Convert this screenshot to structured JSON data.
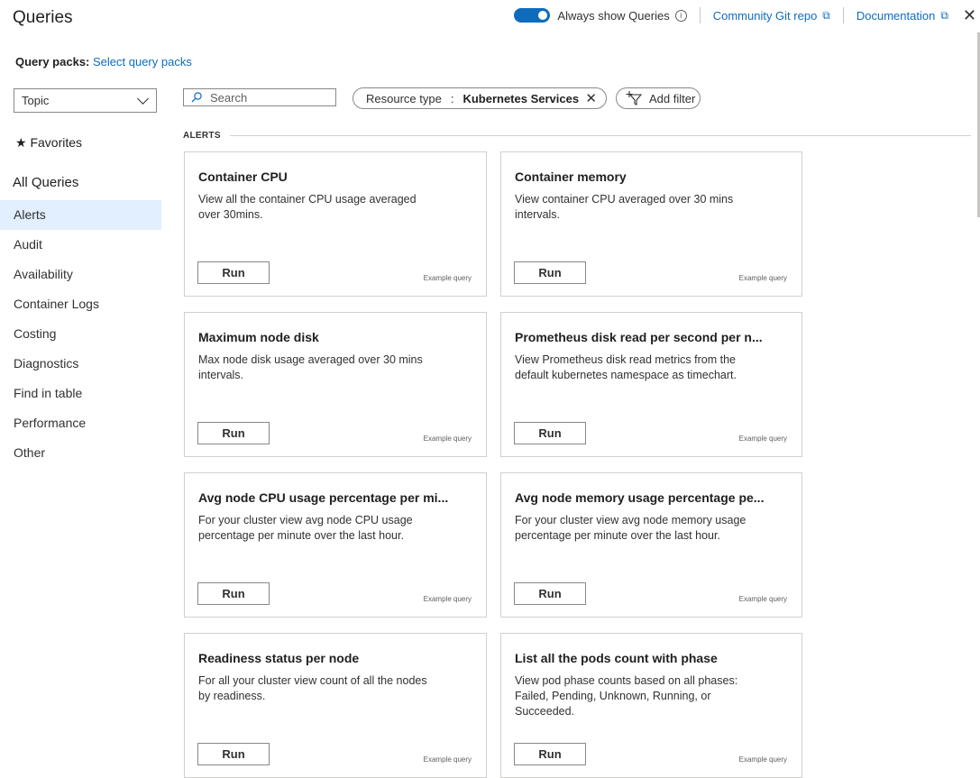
{
  "header": {
    "title": "Queries",
    "always_show_label": "Always show Queries",
    "community_link": "Community Git repo",
    "docs_link": "Documentation",
    "accent": "#0f6cbd"
  },
  "query_packs": {
    "label": "Query packs:",
    "link": "Select query packs"
  },
  "topic_select": {
    "value": "Topic"
  },
  "search": {
    "placeholder": "Search"
  },
  "filter": {
    "resource_type_label": "Resource type",
    "separator": ":",
    "resource_type_value": "Kubernetes Services",
    "add_filter_label": "Add filter"
  },
  "sidebar": {
    "favorites": "Favorites",
    "all_queries": "All Queries",
    "categories": [
      {
        "label": "Alerts",
        "active": true
      },
      {
        "label": "Audit"
      },
      {
        "label": "Availability"
      },
      {
        "label": "Container Logs"
      },
      {
        "label": "Costing"
      },
      {
        "label": "Diagnostics"
      },
      {
        "label": "Find in table"
      },
      {
        "label": "Performance"
      },
      {
        "label": "Other"
      }
    ]
  },
  "section": {
    "heading": "ALERTS"
  },
  "cards": [
    {
      "title": "Container CPU",
      "description": "View all the container CPU usage averaged over 30mins.",
      "run_label": "Run",
      "badge": "Example query"
    },
    {
      "title": "Container memory",
      "description": "View container CPU averaged over 30 mins intervals.",
      "run_label": "Run",
      "badge": "Example query"
    },
    {
      "title": "Maximum node disk",
      "description": "Max node disk usage averaged over 30 mins intervals.",
      "run_label": "Run",
      "badge": "Example query"
    },
    {
      "title": "Prometheus disk read per second per n...",
      "description": "View Prometheus disk read metrics from the default kubernetes namespace as timechart.",
      "run_label": "Run",
      "badge": "Example query"
    },
    {
      "title": "Avg node CPU usage percentage per mi...",
      "description": "For your cluster view avg node CPU usage percentage per minute over the last hour.",
      "run_label": "Run",
      "badge": "Example query"
    },
    {
      "title": "Avg node memory usage percentage pe...",
      "description": "For your cluster view avg node memory usage percentage per minute over the last hour.",
      "run_label": "Run",
      "badge": "Example query"
    },
    {
      "title": "Readiness status per node",
      "description": "For all your cluster view count of all the nodes by readiness.",
      "run_label": "Run",
      "badge": "Example query"
    },
    {
      "title": "List all the pods count with phase",
      "description": "View pod phase counts based on all phases: Failed, Pending, Unknown, Running, or Succeeded.",
      "run_label": "Run",
      "badge": "Example query"
    }
  ]
}
